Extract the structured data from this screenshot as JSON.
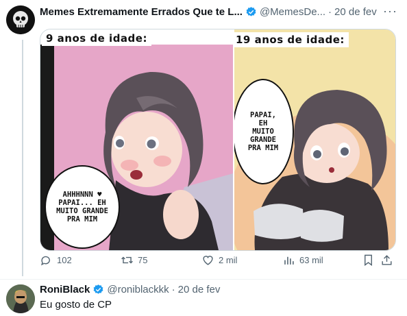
{
  "tweet": {
    "author_name": "Memes Extremamente Errados Que te L...",
    "handle": "@MemesDe...",
    "separator": "·",
    "date": "20 de fev",
    "more_label": "···",
    "panel_left": {
      "caption": "9 anos de idade:",
      "bubble_lines": [
        "AHHHNNN ♥",
        "PAPAI... EH",
        "MUITO GRANDE",
        "PRA MIM"
      ]
    },
    "panel_right": {
      "caption": "19 anos de idade:",
      "bubble_lines": [
        "PAPAI,",
        "EH",
        "MUITO",
        "GRANDE",
        "PRA MIM"
      ]
    },
    "actions": {
      "replies": "102",
      "retweets": "75",
      "likes": "2 mil",
      "views": "63 mil"
    }
  },
  "reply": {
    "author_name": "RoniBlack",
    "handle": "@roniblackkk",
    "separator": "·",
    "date": "20 de fev",
    "text": "Eu gosto de CP"
  },
  "colors": {
    "verified": "#1d9bf0",
    "muted": "#536471",
    "left_panel_bg": "#e6a6c8",
    "right_panel_bg": "#f3e3a8"
  }
}
